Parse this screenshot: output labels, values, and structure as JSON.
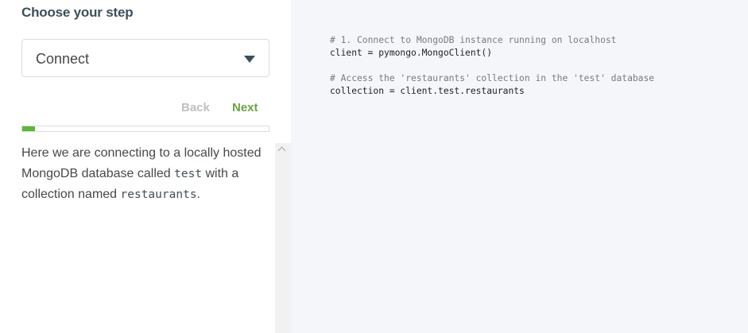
{
  "sidebar": {
    "title": "Choose your step",
    "step_select": {
      "value": "Connect",
      "icon": "caret-down-icon"
    },
    "nav": {
      "back_label": "Back",
      "next_label": "Next"
    },
    "progress": {
      "fraction": 0.05
    },
    "description": {
      "part1": "Here we are connecting to a locally hosted MongoDB database called ",
      "db_name": "test",
      "part2": " with a collection named ",
      "collection_name": "restaurants",
      "part3": "."
    },
    "scrollbar": {
      "icon": "scroll-up-icon"
    }
  },
  "code": {
    "lines": [
      {
        "kind": "comment",
        "text": "# 1. Connect to MongoDB instance running on localhost"
      },
      {
        "kind": "statement",
        "text": "client = pymongo.MongoClient()"
      },
      {
        "kind": "blank",
        "text": ""
      },
      {
        "kind": "comment",
        "text": "# Access the 'restaurants' collection in the 'test' database"
      },
      {
        "kind": "statement",
        "text": "collection = client.test.restaurants"
      }
    ]
  },
  "colors": {
    "accent_green": "#6ba442",
    "progress_green": "#5bb834",
    "code_background": "#f5f6fa"
  }
}
